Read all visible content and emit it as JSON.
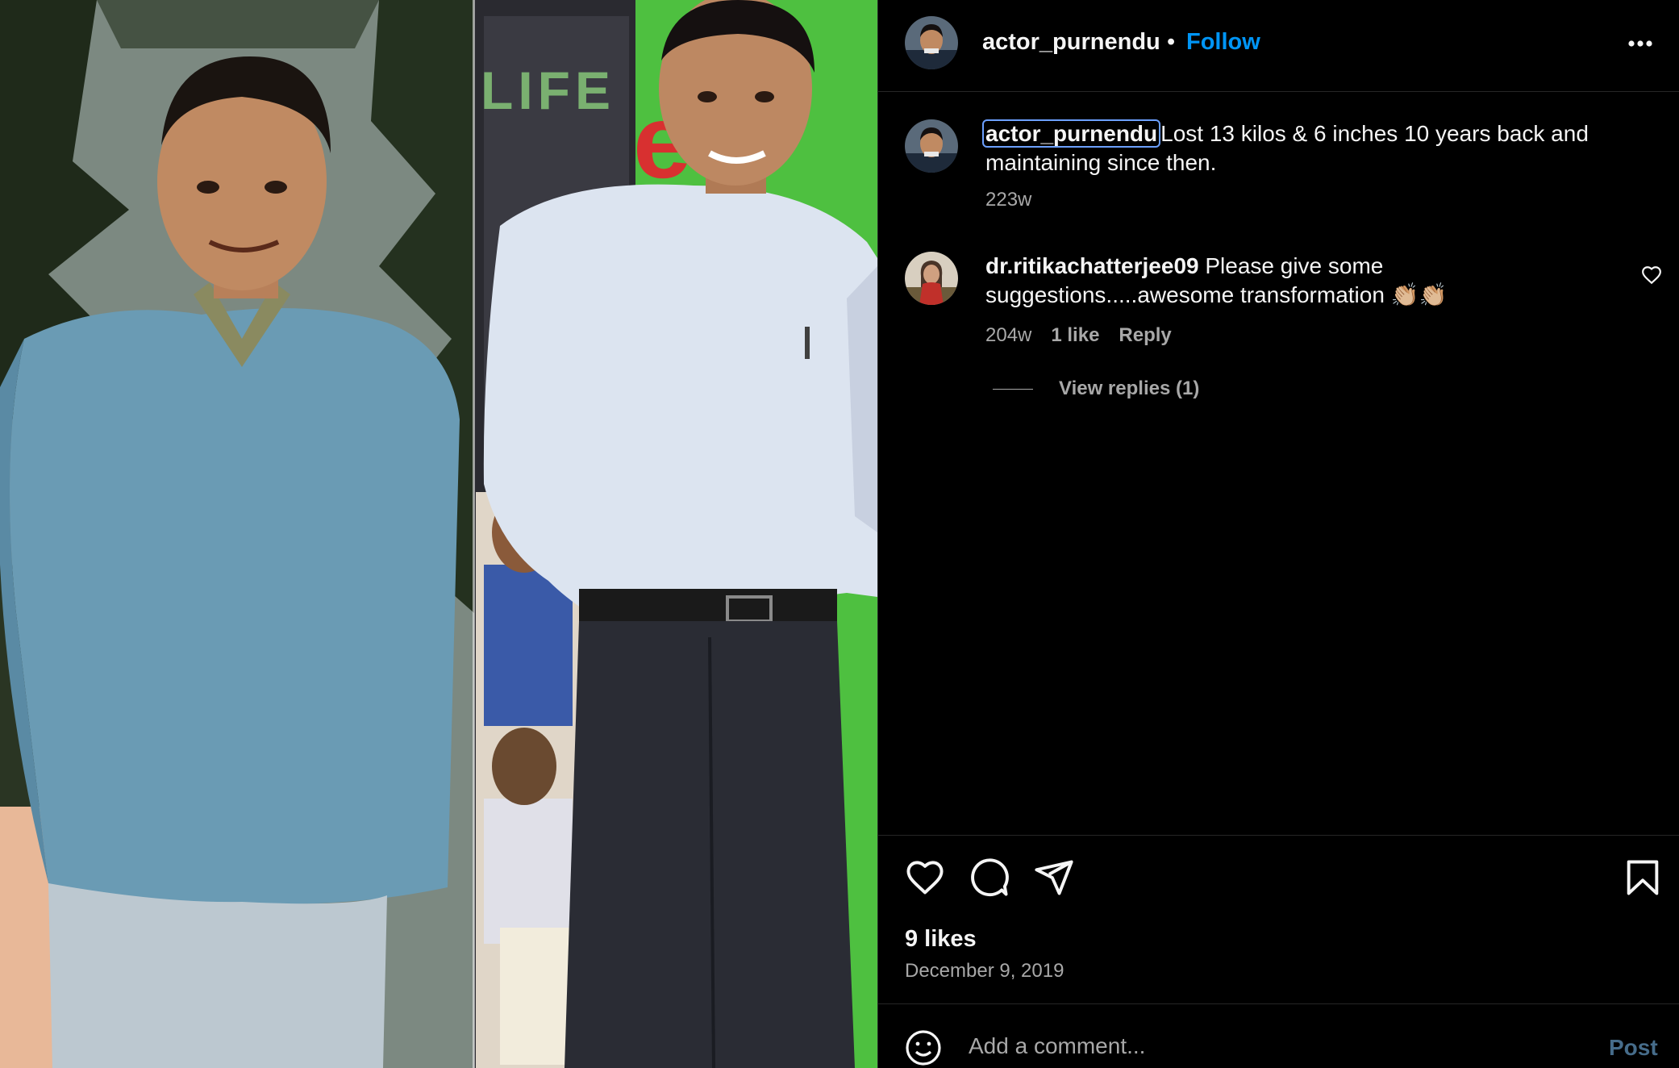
{
  "post": {
    "username": "actor_purnendu",
    "separator": "•",
    "follow_label": "Follow",
    "more_icon": "more-options-icon"
  },
  "caption": {
    "username": "actor_purnendu",
    "text": "Lost 13 kilos & 6 inches 10 years back and maintaining since then.",
    "time": "223w"
  },
  "comment": {
    "username": "dr.ritikachatterjee09",
    "text": "Please give some suggestions.....awesome transformation 👏🏼👏🏼",
    "time": "204w",
    "likes": "1 like",
    "reply_label": "Reply",
    "view_replies": "View replies (1)"
  },
  "footer": {
    "likes": "9 likes",
    "date": "December 9, 2019",
    "comment_placeholder": "Add a comment...",
    "post_label": "Post"
  },
  "media": {
    "banner_text": "LIFE",
    "banner_red_text": "eu"
  },
  "colors": {
    "accent": "#0095f6",
    "muted": "#a8a8a8",
    "post_disabled": "#466c8a",
    "highlight": "#6ca0ff"
  }
}
